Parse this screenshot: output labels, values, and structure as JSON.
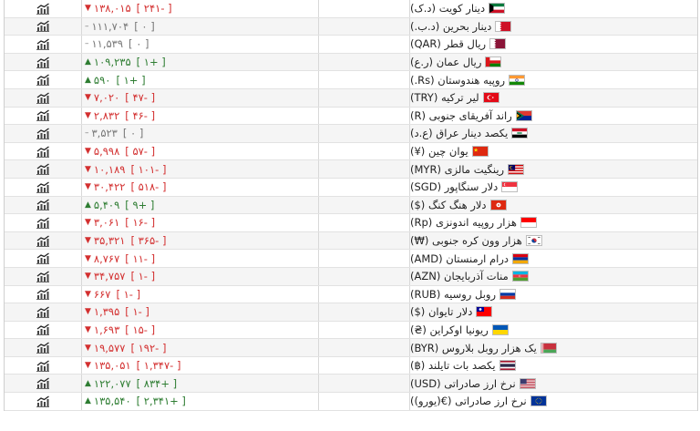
{
  "rows": [
    {
      "name": "دینار کویت (د.ک)",
      "flag": "kuwait",
      "price": "۱۳۸,۰۱۵",
      "change": "[ ۲۴۱- ]",
      "dir": "down"
    },
    {
      "name": "دینار بحرین (د.ب.)",
      "flag": "bahrain",
      "price": "۱۱۱,۷۰۴",
      "change": "[ ۰ ]",
      "dir": "none"
    },
    {
      "name": "ریال قطر (QAR)",
      "flag": "qatar",
      "price": "۱۱,۵۳۹",
      "change": "[ ۰ ]",
      "dir": "none"
    },
    {
      "name": "ریال عمان (ر.ع)",
      "flag": "oman",
      "price": "۱۰۹,۲۳۵",
      "change": "[ ۱+ ]",
      "dir": "up"
    },
    {
      "name": "روپیه هندوستان (Rs.)",
      "flag": "india",
      "price": "۵۹۰",
      "change": "[ ۱+ ]",
      "dir": "up"
    },
    {
      "name": "لیر ترکیه (TRY)",
      "flag": "turkey",
      "price": "۷,۰۲۰",
      "change": "[ ۴۷- ]",
      "dir": "down"
    },
    {
      "name": "راند آفریقای جنوبی (R)",
      "flag": "southafrica",
      "price": "۲,۸۳۲",
      "change": "[ ۴۶- ]",
      "dir": "down"
    },
    {
      "name": "یکصد دینار عراق (ع.د)",
      "flag": "iraq",
      "price": "۳,۵۲۳",
      "change": "[ ۰ ]",
      "dir": "none"
    },
    {
      "name": "یوان چین (¥)",
      "flag": "china",
      "price": "۵,۹۹۸",
      "change": "[ ۵۷- ]",
      "dir": "down"
    },
    {
      "name": "رینگیت مالزی (MYR)",
      "flag": "malaysia",
      "price": "۱۰,۱۸۹",
      "change": "[ ۱۰۱- ]",
      "dir": "down"
    },
    {
      "name": "دلار سنگاپور (SGD)",
      "flag": "singapore",
      "price": "۳۰,۴۲۲",
      "change": "[ ۵۱۸- ]",
      "dir": "down"
    },
    {
      "name": "دلار هنگ کنگ ($)",
      "flag": "hongkong",
      "price": "۵,۴۰۹",
      "change": "[ ۹+ ]",
      "dir": "up"
    },
    {
      "name": "هزار روپیه اندونزی (Rp)",
      "flag": "indonesia",
      "price": "۳,۰۶۱",
      "change": "[ ۱۶- ]",
      "dir": "down"
    },
    {
      "name": "هزار وون کره جنوبی (₩)",
      "flag": "korea",
      "price": "۳۵,۳۲۱",
      "change": "[ ۳۶۵- ]",
      "dir": "down"
    },
    {
      "name": "درام ارمنستان (AMD)",
      "flag": "armenia",
      "price": "۸,۷۶۷",
      "change": "[ ۱۱- ]",
      "dir": "down"
    },
    {
      "name": "منات آذربایجان (AZN)",
      "flag": "azerbaijan",
      "price": "۳۴,۷۵۷",
      "change": "[ ۱- ]",
      "dir": "down"
    },
    {
      "name": "روبل روسیه (RUB)",
      "flag": "russia",
      "price": "۶۶۷",
      "change": "[ ۱- ]",
      "dir": "down"
    },
    {
      "name": "دلار تایوان ($)",
      "flag": "taiwan",
      "price": "۱,۳۹۵",
      "change": "[ ۱- ]",
      "dir": "down"
    },
    {
      "name": "ریونیا اوکراین (₴)",
      "flag": "ukraine",
      "price": "۱,۶۹۳",
      "change": "[ ۱۵- ]",
      "dir": "down"
    },
    {
      "name": "یک هزار روبل بلاروس (BYR)",
      "flag": "belarus",
      "price": "۱۹,۵۷۷",
      "change": "[ ۱۹۲- ]",
      "dir": "down"
    },
    {
      "name": "یکصد بات تایلند (฿)",
      "flag": "thailand",
      "price": "۱۳۵,۰۵۱",
      "change": "[ ۱,۳۴۷- ]",
      "dir": "down"
    },
    {
      "name": "نرخ ارز صادراتی (USD)",
      "flag": "usa",
      "price": "۱۲۲,۰۷۷",
      "change": "[ ۸۳۴+ ]",
      "dir": "up"
    },
    {
      "name": "نرخ ارز صادراتی (€(یورو))",
      "flag": "eu",
      "price": "۱۳۵,۵۴۰",
      "change": "[ ۲,۳۴۱+ ]",
      "dir": "up"
    }
  ],
  "icons": {
    "chart": "line-chart-icon",
    "up": "up-arrow-icon",
    "down": "down-arrow-icon",
    "none": "dash-icon"
  },
  "colors": {
    "down": "#d32f2f",
    "up": "#2e7d32",
    "none": "#777777"
  }
}
